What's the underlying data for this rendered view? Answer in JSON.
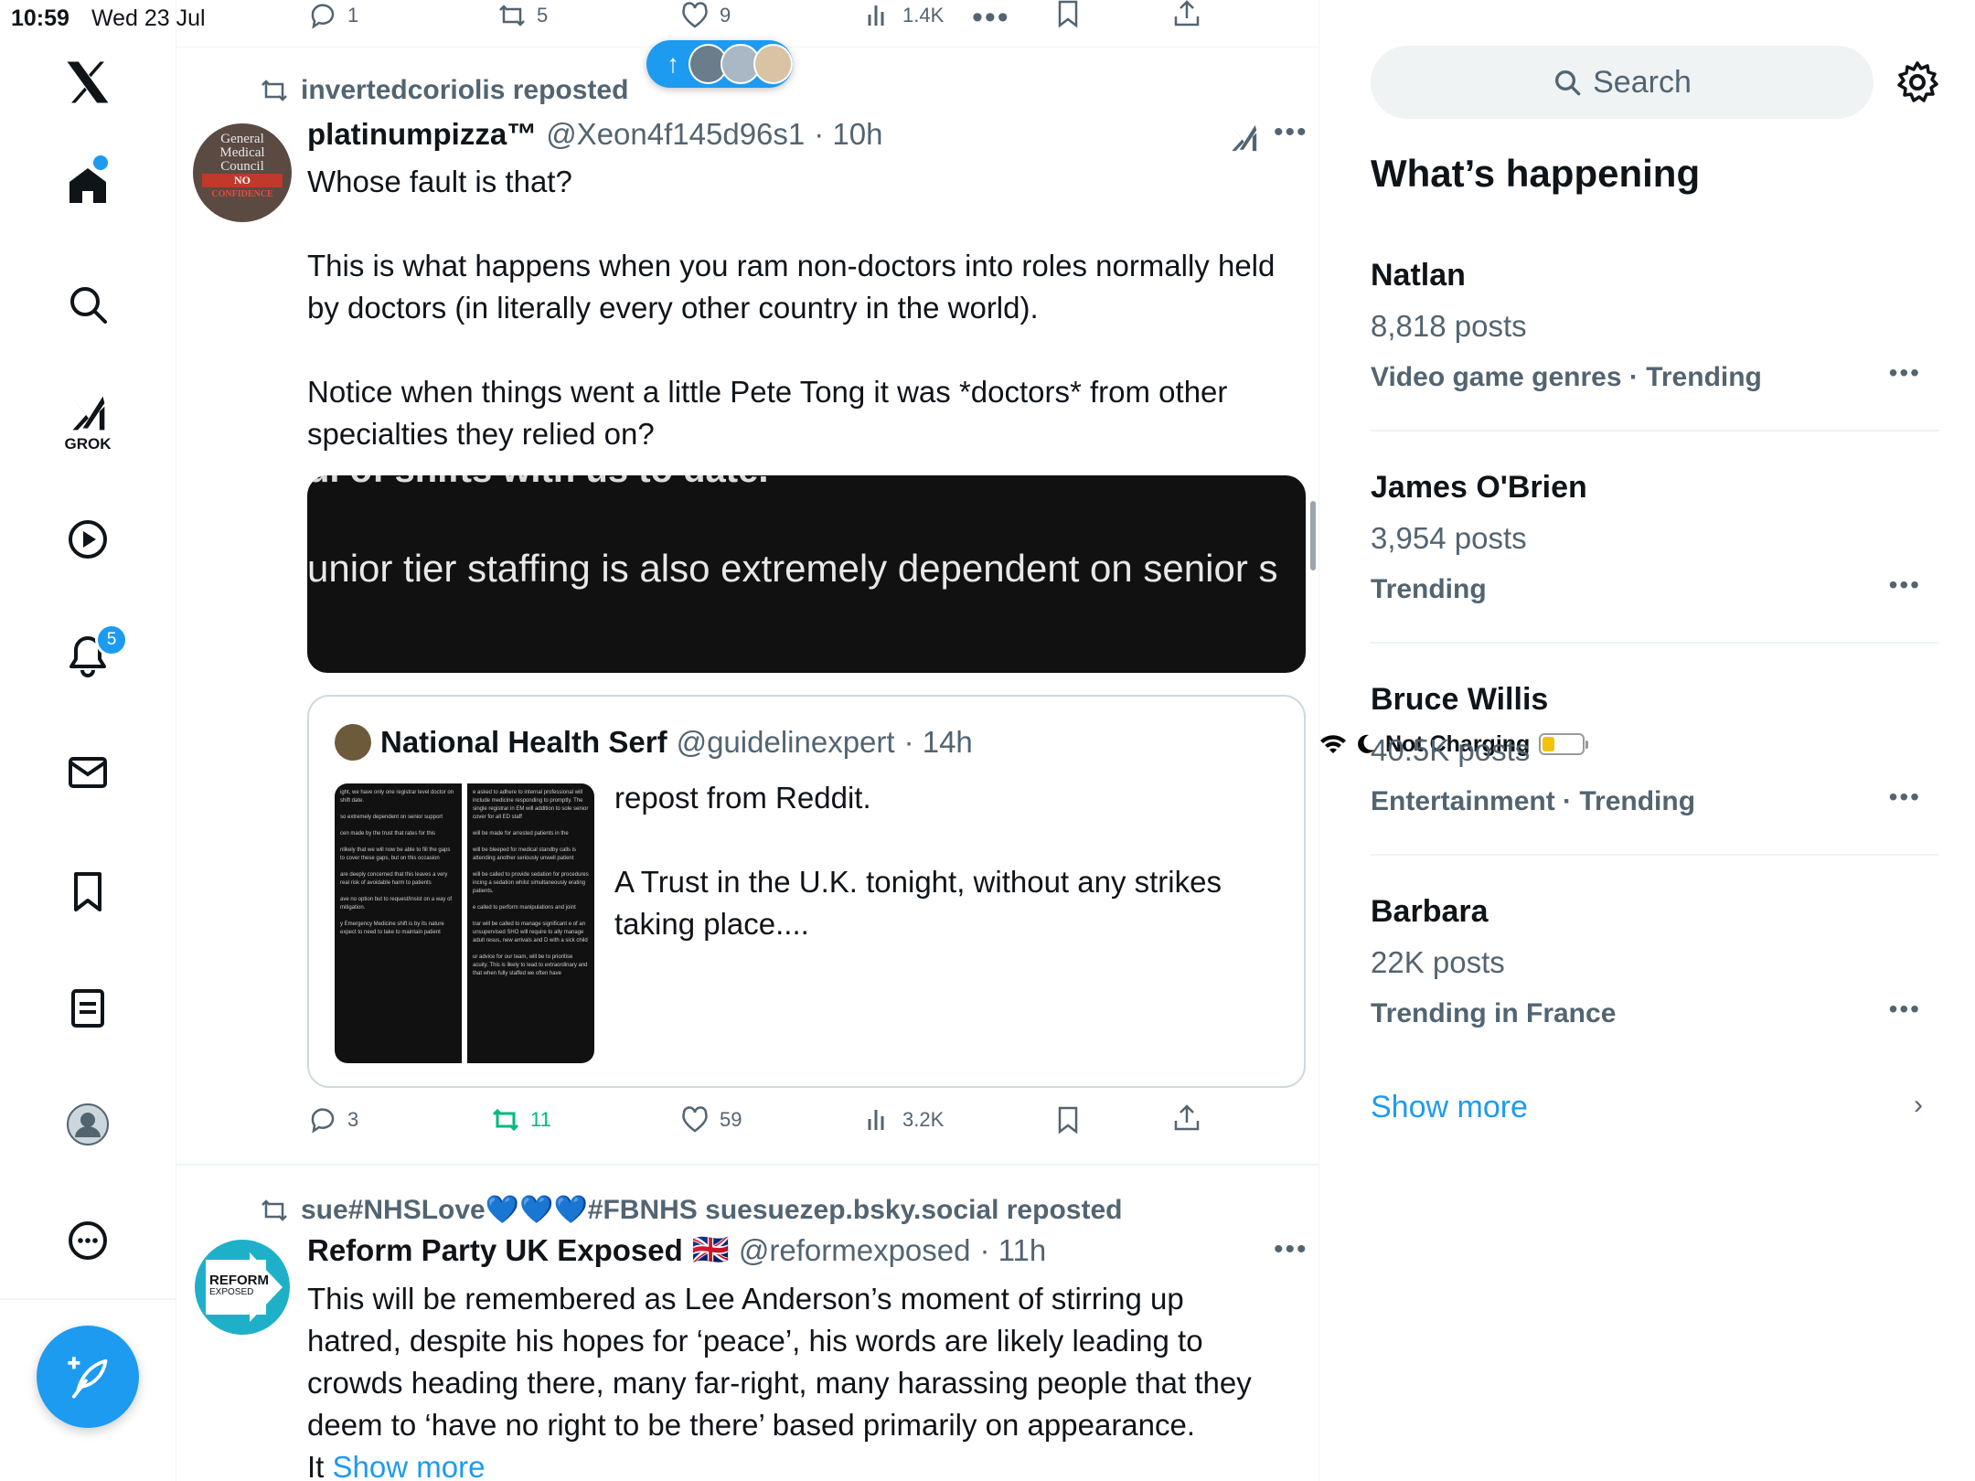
{
  "status": {
    "time": "10:59",
    "date": "Wed 23 Jul",
    "battery_text": "Not Charging",
    "battery_percent": 30
  },
  "nav": {
    "notifications_badge": "5",
    "grok_label": "GROK"
  },
  "top_actions": {
    "replies": "1",
    "reposts": "5",
    "likes": "9",
    "views": "1.4K"
  },
  "post1": {
    "reposted_by": "invertedcoriolis reposted",
    "name": "platinumpizza™",
    "handle": "@Xeon4f145d96s1",
    "time": "· 10h",
    "text": "Whose fault is that?\n\nThis is what happens when you ram non-doctors into roles normally held by doctors (in literally every other country in the world).\n\nNotice when things went a little Pete Tong it was *doctors* from other specialties they relied on?",
    "media_line1": "ul of shifts with us to date.",
    "media_line2": "unior tier staffing is also  extremely dependent on senior s",
    "avatar_text": [
      "General",
      "Medical",
      "Council",
      "NO",
      "CONFIDENCE"
    ],
    "quote": {
      "name": "National Health Serf",
      "handle": "@guidelinexpert",
      "time": "· 14h",
      "text": "repost from Reddit.\n\nA Trust in the U.K. tonight, without any strikes taking place....",
      "doc_col1": "ight, we have only one registrar level doctor on shift date.\n\nso extremely dependent on senior support\n\ncen made by the trust that rates for this\n\nnlikely that we will now be able to fill the gaps to cover these gaps, but on this occasion\n\nare deeply concerned that this leaves a very real risk of avoidable harm to patients\n\nave no option but to request/insist on a way of mitigation.\n\ny Emergency Medicine shift is by its nature expect to need to take to maintain patient",
      "doc_col2": "e asked to adhere to internal professional will include medicine responding to promptly. The single registrar in EM will addition to sole senior cover for all ED staff\n\nwill be made for arrested patients in the\n\nwill be bleeped for medical standby calls is attending another seriously unwell patient\n\nwill be called to provide sedation for procedures incing a sedation whilst simultaneously erating patients.\n\ne called to perform manipulations and joint\n\ntrar will be called to manage significant e of an unsupervised SHO will require to ally manage adult resus, new arrivals and D with a sick child\n\nur advice for our team, will be to prioritise acuity. This is likely to lead to extraordinary and that when fully staffed we often have"
    },
    "actions": {
      "replies": "3",
      "reposts": "11",
      "likes": "59",
      "views": "3.2K"
    }
  },
  "post2": {
    "reposted_by": "sue#NHSLove💙💙💙#FBNHS suesuezep.bsky.social reposted",
    "name": "Reform Party UK Exposed",
    "flag": "🇬🇧",
    "handle": "@reformexposed",
    "time": "· 11h",
    "text": "This will be remembered as Lee Anderson’s moment of stirring up hatred, despite his hopes for ‘peace’, his words are likely leading to crowds heading there, many far-right, many harassing people that they deem to ‘have no right to be there’ based primarily on appearance.",
    "text_tail": "It ",
    "show_more": "Show more",
    "avatar_text1": "REFORM",
    "avatar_text2": "EXPOSED"
  },
  "sidebar": {
    "search_placeholder": "Search",
    "heading": "What’s happening",
    "trends": [
      {
        "name": "Natlan",
        "posts": "8,818 posts",
        "category": "Video game genres · Trending"
      },
      {
        "name": "James O'Brien",
        "posts": "3,954 posts",
        "category": "Trending"
      },
      {
        "name": "Bruce Willis",
        "posts": "40.5K posts",
        "category": "Entertainment · Trending"
      },
      {
        "name": "Barbara",
        "posts": "22K posts",
        "category": "Trending in France"
      }
    ],
    "show_more": "Show more"
  },
  "colors": {
    "accent": "#1d9bf0",
    "secondary_text": "#536471",
    "repost_green": "#00ba7c"
  }
}
